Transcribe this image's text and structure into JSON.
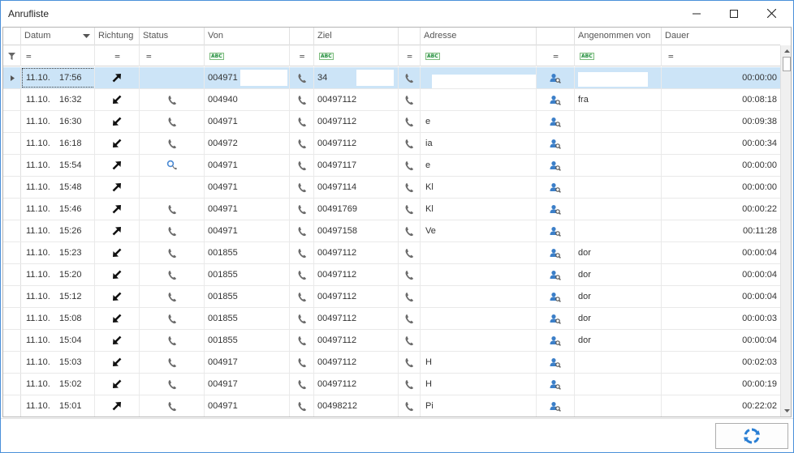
{
  "window": {
    "title": "Anrufliste"
  },
  "columns": [
    {
      "key": "datum",
      "label": "Datum",
      "sorted": "desc"
    },
    {
      "key": "richtung",
      "label": "Richtung"
    },
    {
      "key": "status",
      "label": "Status"
    },
    {
      "key": "von",
      "label": "Von"
    },
    {
      "key": "von_call",
      "label": ""
    },
    {
      "key": "ziel",
      "label": "Ziel"
    },
    {
      "key": "ziel_call",
      "label": ""
    },
    {
      "key": "adresse",
      "label": "Adresse"
    },
    {
      "key": "lookup",
      "label": ""
    },
    {
      "key": "angenommen",
      "label": "Angenommen von"
    },
    {
      "key": "dauer",
      "label": "Dauer"
    }
  ],
  "filter_symbols": {
    "equals": "=",
    "text": "ABC"
  },
  "rows": [
    {
      "date": "11.10.",
      "time": "17:56",
      "direction": "outgoing",
      "status": "",
      "von": "004971",
      "ziel": "34",
      "adresse": "",
      "angenommen": "",
      "dauer": "00:00:00"
    },
    {
      "date": "11.10.",
      "time": "16:32",
      "direction": "incoming",
      "status": "phone",
      "von": "004940",
      "ziel": "00497112",
      "adresse": "",
      "angenommen": "fra",
      "dauer": "00:08:18"
    },
    {
      "date": "11.10.",
      "time": "16:30",
      "direction": "incoming",
      "status": "phone",
      "von": "004971",
      "ziel": "00497112",
      "adresse": "e",
      "angenommen": "",
      "dauer": "00:09:38"
    },
    {
      "date": "11.10.",
      "time": "16:18",
      "direction": "incoming",
      "status": "phone",
      "von": "004972",
      "ziel": "00497112",
      "adresse": "ia",
      "angenommen": "",
      "dauer": "00:00:34"
    },
    {
      "date": "11.10.",
      "time": "15:54",
      "direction": "outgoing",
      "status": "voicemail",
      "von": "004971",
      "ziel": "00497117",
      "adresse": "e",
      "angenommen": "",
      "dauer": "00:00:00"
    },
    {
      "date": "11.10.",
      "time": "15:48",
      "direction": "outgoing",
      "status": "",
      "von": "004971",
      "ziel": "00497114",
      "adresse": "Kl",
      "angenommen": "",
      "dauer": "00:00:00"
    },
    {
      "date": "11.10.",
      "time": "15:46",
      "direction": "outgoing",
      "status": "phone",
      "von": "004971",
      "ziel": "00491769",
      "adresse": "Kl",
      "angenommen": "",
      "dauer": "00:00:22"
    },
    {
      "date": "11.10.",
      "time": "15:26",
      "direction": "outgoing",
      "status": "phone",
      "von": "004971",
      "ziel": "00497158",
      "adresse": "Ve",
      "angenommen": "",
      "dauer": "00:11:28"
    },
    {
      "date": "11.10.",
      "time": "15:23",
      "direction": "incoming",
      "status": "phone",
      "von": "001855",
      "ziel": "00497112",
      "adresse": "",
      "angenommen": "dor",
      "dauer": "00:00:04"
    },
    {
      "date": "11.10.",
      "time": "15:20",
      "direction": "incoming",
      "status": "phone",
      "von": "001855",
      "ziel": "00497112",
      "adresse": "",
      "angenommen": "dor",
      "dauer": "00:00:04"
    },
    {
      "date": "11.10.",
      "time": "15:12",
      "direction": "incoming",
      "status": "phone",
      "von": "001855",
      "ziel": "00497112",
      "adresse": "",
      "angenommen": "dor",
      "dauer": "00:00:04"
    },
    {
      "date": "11.10.",
      "time": "15:08",
      "direction": "incoming",
      "status": "phone",
      "von": "001855",
      "ziel": "00497112",
      "adresse": "",
      "angenommen": "dor",
      "dauer": "00:00:03"
    },
    {
      "date": "11.10.",
      "time": "15:04",
      "direction": "incoming",
      "status": "phone",
      "von": "001855",
      "ziel": "00497112",
      "adresse": "",
      "angenommen": "dor",
      "dauer": "00:00:04"
    },
    {
      "date": "11.10.",
      "time": "15:03",
      "direction": "incoming",
      "status": "phone",
      "von": "004917",
      "ziel": "00497112",
      "adresse": "H",
      "angenommen": "",
      "dauer": "00:02:03"
    },
    {
      "date": "11.10.",
      "time": "15:02",
      "direction": "incoming",
      "status": "phone",
      "von": "004917",
      "ziel": "00497112",
      "adresse": "H",
      "angenommen": "",
      "dauer": "00:00:19"
    },
    {
      "date": "11.10.",
      "time": "15:01",
      "direction": "outgoing",
      "status": "phone",
      "von": "004971",
      "ziel": "00498212",
      "adresse": "Pi",
      "angenommen": "",
      "dauer": "00:22:02"
    }
  ],
  "selected_row": 0,
  "colors": {
    "selection": "#cce4f7",
    "window_border": "#4a90d9",
    "refresh_icon": "#2a7fd4",
    "lookup_icon": "#3c7fc8"
  }
}
